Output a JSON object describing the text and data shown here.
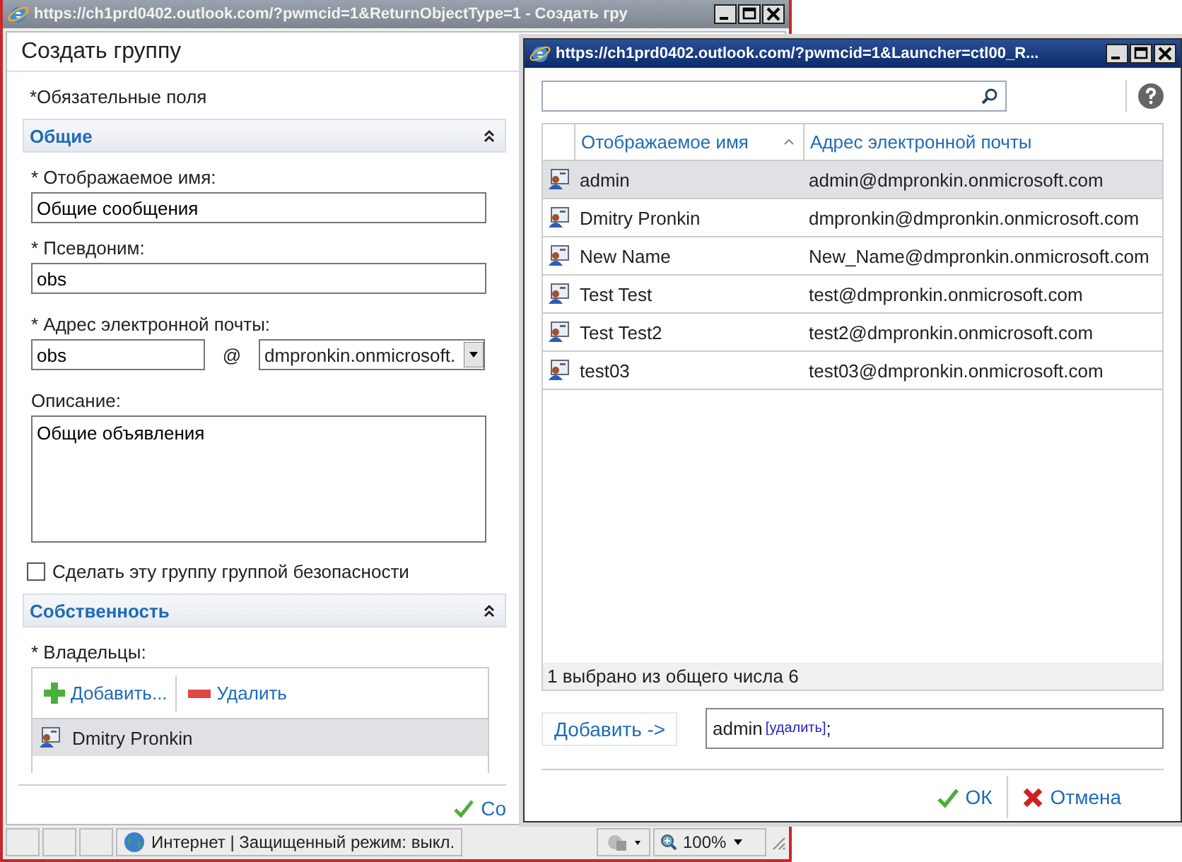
{
  "main_window": {
    "title": "https://ch1prd0402.outlook.com/?pwmcid=1&ReturnObjectType=1 - Создать гру",
    "heading": "Создать группу",
    "required_note": "*Обязательные поля",
    "general_section": {
      "title": "Общие",
      "expanded": true
    },
    "display_name": {
      "label": "* Отображаемое имя:",
      "value": "Общие сообщения"
    },
    "alias": {
      "label": "* Псевдоним:",
      "value": "obs"
    },
    "email": {
      "label": "* Адрес электронной почты:",
      "value": "obs",
      "at": "@",
      "domain": "dmpronkin.onmicrosoft."
    },
    "description": {
      "label": "Описание:",
      "value": "Общие объявления"
    },
    "security_group": {
      "label": "Сделать эту группу группой безопасности",
      "checked": false
    },
    "ownership_section": {
      "title": "Собственность",
      "expanded": true
    },
    "owners": {
      "label": "* Владельцы:",
      "add_button": "Добавить...",
      "remove_button": "Удалить",
      "items": [
        {
          "name": "Dmitry Pronkin",
          "selected": true
        }
      ]
    },
    "save_button": "Со",
    "status_bar": {
      "zone": "Интернет | Защищенный режим: выкл.",
      "zoom": "100%"
    }
  },
  "picker_window": {
    "title": "https://ch1prd0402.outlook.com/?pwmcid=1&Launcher=ctl00_R...",
    "table": {
      "columns": [
        {
          "label": "Отображаемое имя",
          "sorted": true
        },
        {
          "label": "Адрес электронной почты",
          "sorted": false
        }
      ],
      "rows": [
        {
          "name": "admin",
          "email": "admin@dmpronkin.onmicrosoft.com",
          "selected": true
        },
        {
          "name": "Dmitry Pronkin",
          "email": "dmpronkin@dmpronkin.onmicrosoft.com",
          "selected": false
        },
        {
          "name": "New Name",
          "email": "New_Name@dmpronkin.onmicrosoft.com",
          "selected": false
        },
        {
          "name": "Test Test",
          "email": "test@dmpronkin.onmicrosoft.com",
          "selected": false
        },
        {
          "name": "Test Test2",
          "email": "test2@dmpronkin.onmicrosoft.com",
          "selected": false
        },
        {
          "name": "test03",
          "email": "test03@dmpronkin.onmicrosoft.com",
          "selected": false
        }
      ],
      "footer": "1 выбрано из общего числа 6"
    },
    "add_button": "Добавить ->",
    "selected_recipients": [
      {
        "name": "admin",
        "remove_link": "[удалить]"
      }
    ],
    "separator": ";",
    "ok_button": "ОК",
    "cancel_button": "Отмена"
  }
}
